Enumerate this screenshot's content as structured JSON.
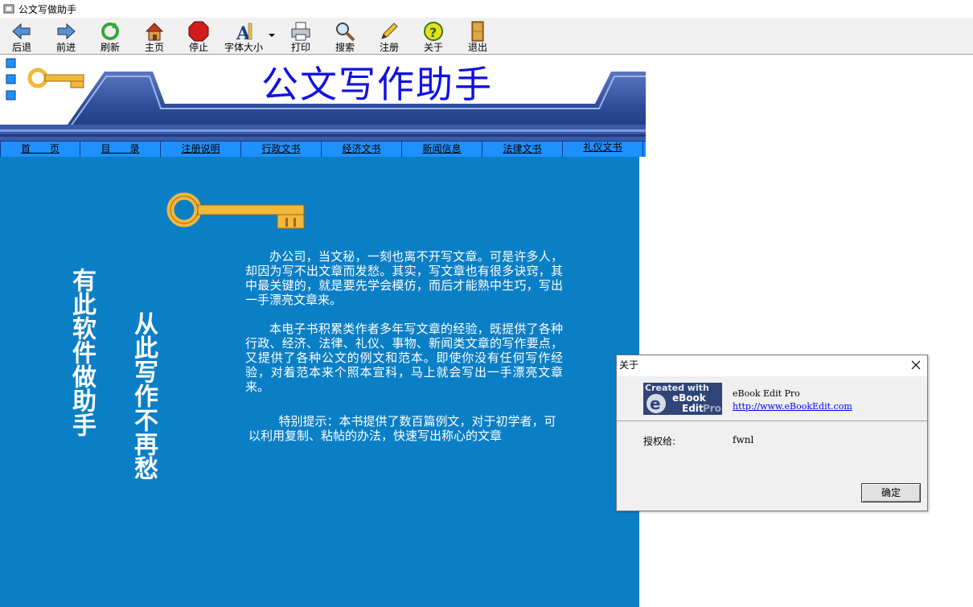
{
  "window": {
    "title": "公文写做助手",
    "icon": "book-icon"
  },
  "toolbar": {
    "back": "后退",
    "forward": "前进",
    "refresh": "刷新",
    "home": "主页",
    "stop": "停止",
    "font_size": "字体大小",
    "print": "打印",
    "search": "搜索",
    "register": "注册",
    "about": "关于",
    "exit": "退出"
  },
  "banner": {
    "title": "公文写作助手"
  },
  "nav": [
    "首　　页",
    "目　　录",
    "注册说明",
    "行政文书",
    "经济文书",
    "新闻信息",
    "法律文书",
    "礼仪文书"
  ],
  "main": {
    "slogan_1": "有此软件做助手",
    "slogan_2": "从此写作不再愁",
    "para_1": "办公司，当文秘，一刻也离不开写文章。可是许多人，却因为写不出文章而发愁。其实，写文章也有很多诀窍，其中最关键的，就是要先学会模仿，而后才能熟中生巧，写出一手漂亮文章来。",
    "para_2": "本电子书积累类作者多年写文章的经验，既提供了各种行政、经济、法律、礼仪、事物、新闻类文章的写作要点，又提供了各种公文的例文和范本。即使你没有任何写作经验，对着范本来个照本宣科，马上就会写出一手漂亮文章来。",
    "para_3": "特别提示：本书提供了数百篇例文，对于初学者，可以利用复制、粘帖的办法，快速写出称心的文章"
  },
  "about_dialog": {
    "title": "关于",
    "logo_line1": "Created with",
    "logo_line2": "eBook",
    "logo_line3": "Edit",
    "logo_line4": "Pro",
    "product": "eBook Edit Pro",
    "link": "http://www.eBookEdit.com",
    "license_label": "授权给:",
    "license_value": "fwnl",
    "ok": "确定"
  },
  "colors": {
    "pane_blue": "#0b7fc6",
    "nav_blue": "#1e90ff",
    "title_blue": "#1010e0"
  }
}
